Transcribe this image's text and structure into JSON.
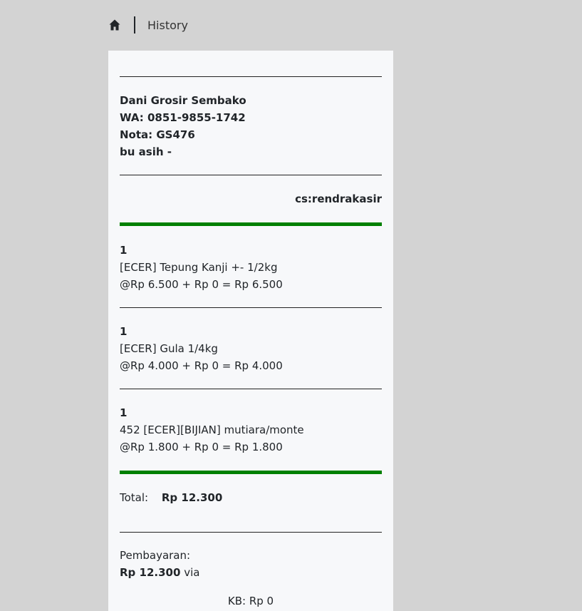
{
  "breadcrumb": {
    "current": "History"
  },
  "store": {
    "name": "Dani Grosir Sembako",
    "wa": "WA: 0851-9855-1742",
    "nota": "Nota: GS476",
    "customer": "bu asih -"
  },
  "cashier": "cs:rendrakasir",
  "items": [
    {
      "qty": "1",
      "name": "[ECER] Tepung Kanji +- 1/2kg",
      "calc": "@Rp 6.500 + Rp 0 = Rp 6.500"
    },
    {
      "qty": "1",
      "name": "[ECER] Gula 1/4kg",
      "calc": "@Rp 4.000 + Rp 0 = Rp 4.000"
    },
    {
      "qty": "1",
      "name": "452 [ECER][BIJIAN] mutiara/monte",
      "calc": "@Rp 1.800 + Rp 0 = Rp 1.800"
    }
  ],
  "total": {
    "label": "Total:",
    "value": "Rp 12.300"
  },
  "payment": {
    "label": "Pembayaran:",
    "amount": "Rp 12.300",
    "via": "via"
  },
  "kb": "KB: Rp 0",
  "colors": {
    "background": "#d3d3d3",
    "receipt": "#f7f8fa",
    "green": "#008000"
  },
  "icons": {
    "home": "home-icon"
  }
}
